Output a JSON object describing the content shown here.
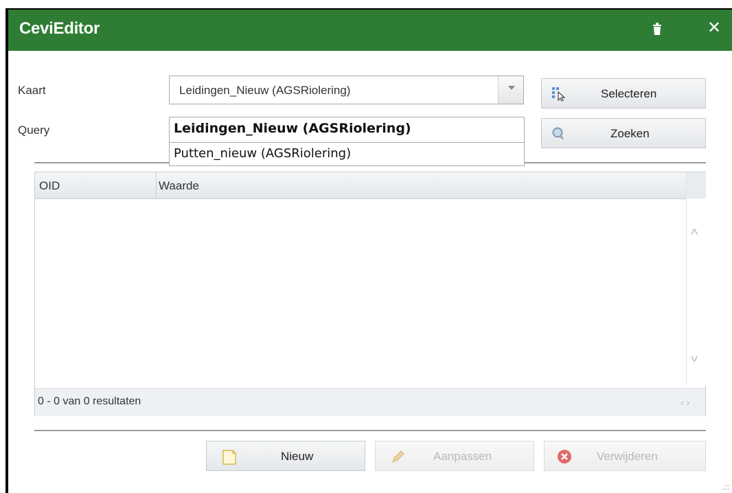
{
  "window": {
    "title": "CeviEditor"
  },
  "titlebar": {
    "trash_icon": "trash-icon",
    "close_glyph": "✕"
  },
  "form": {
    "kaart_label": "Kaart",
    "query_label": "Query",
    "kaart_select": {
      "value": "Leidingen_Nieuw (AGSRiolering)",
      "options": [
        "Leidingen_Nieuw (AGSRiolering)",
        "Putten_nieuw (AGSRiolering)"
      ]
    }
  },
  "buttons": {
    "selecteren": "Selecteren",
    "zoeken": "Zoeken",
    "nieuw": "Nieuw",
    "aanpassen": "Aanpassen",
    "verwijderen": "Verwijderen"
  },
  "grid": {
    "columns": [
      "OID",
      "Waarde"
    ],
    "rows": [],
    "footer": "0 - 0 van 0 resultaten"
  },
  "colors": {
    "titlebar": "#2f7d34"
  }
}
